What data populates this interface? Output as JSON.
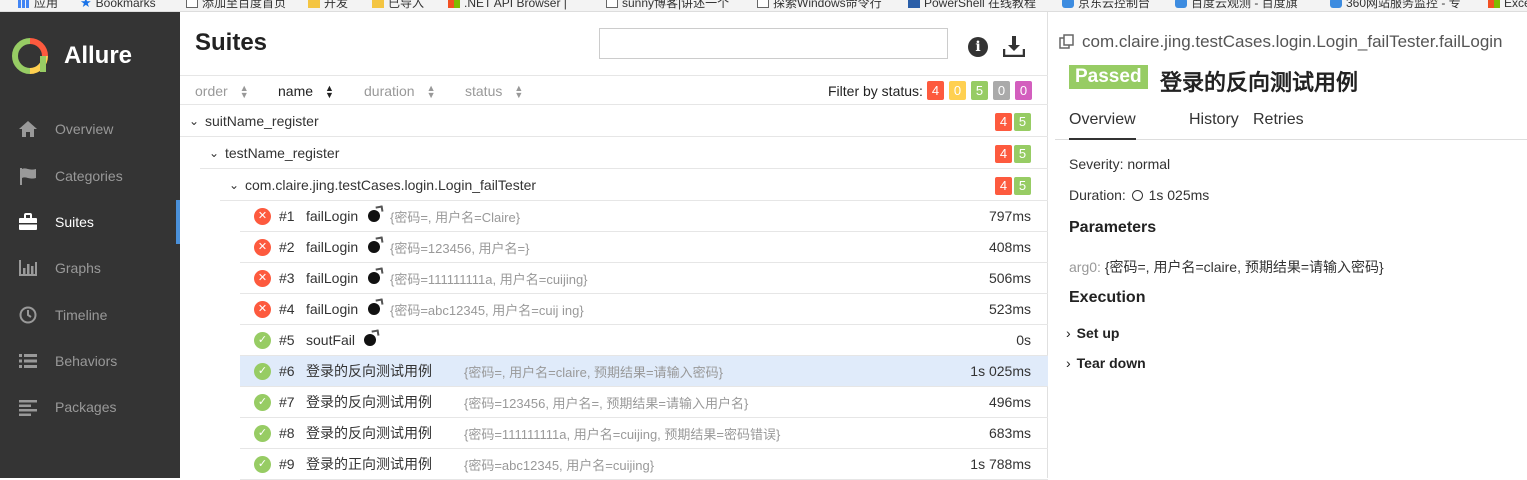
{
  "bookmarks": {
    "items": [
      {
        "label": "应用",
        "icon": "apps-icon"
      },
      {
        "label": "Bookmarks",
        "icon": "star-icon"
      },
      {
        "label": "添加至百度首页",
        "icon": "page-icon"
      },
      {
        "label": "开发",
        "icon": "folder-icon"
      },
      {
        "label": "已导入",
        "icon": "folder-icon"
      },
      {
        "label": ".NET API Browser | ",
        "icon": "microsoft-icon"
      },
      {
        "label": "sunny博客|讲述一个",
        "icon": "page-icon"
      },
      {
        "label": "探索Windows命令行",
        "icon": "page-icon"
      },
      {
        "label": "PowerShell 在线教程",
        "icon": "powershell-icon"
      },
      {
        "label": "京东云控制台",
        "icon": "cloud-icon"
      },
      {
        "label": "百度云观测 - 百度旗",
        "icon": "cloud-icon"
      },
      {
        "label": "360网站服务监控 - 专",
        "icon": "cloud-icon"
      },
      {
        "label": "Exce",
        "icon": "excel-icon"
      }
    ]
  },
  "sidebar": {
    "brand": "Allure",
    "items": [
      {
        "label": "Overview",
        "icon": "home-icon"
      },
      {
        "label": "Categories",
        "icon": "flag-icon"
      },
      {
        "label": "Suites",
        "icon": "briefcase-icon",
        "active": true
      },
      {
        "label": "Graphs",
        "icon": "bar-chart-icon"
      },
      {
        "label": "Timeline",
        "icon": "clock-icon"
      },
      {
        "label": "Behaviors",
        "icon": "list-icon"
      },
      {
        "label": "Packages",
        "icon": "align-left-icon"
      }
    ]
  },
  "suites": {
    "title": "Suites",
    "search_value": "",
    "info_label": "i",
    "sort": {
      "order": "order",
      "name": "name",
      "duration": "duration",
      "status": "status"
    },
    "filter": {
      "label": "Filter by status:",
      "failed": "4",
      "broken": "0",
      "passed": "5",
      "skipped": "0",
      "unknown": "0"
    },
    "groups": [
      {
        "name": "suitName_register",
        "failed": "4",
        "passed": "5"
      },
      {
        "name": "testName_register",
        "failed": "4",
        "passed": "5"
      },
      {
        "name": "com.claire.jing.testCases.login.Login_failTester",
        "failed": "4",
        "passed": "5"
      }
    ],
    "tests": [
      {
        "status": "failed",
        "num": "#1",
        "name": "failLogin",
        "params": "{密码=, 用户名=Claire}",
        "duration": "797ms",
        "bomb": true
      },
      {
        "status": "failed",
        "num": "#2",
        "name": "failLogin",
        "params": "{密码=123456, 用户名=}",
        "duration": "408ms",
        "bomb": true
      },
      {
        "status": "failed",
        "num": "#3",
        "name": "failLogin",
        "params": "{密码=111111111a, 用户名=cuijing}",
        "duration": "506ms",
        "bomb": true
      },
      {
        "status": "failed",
        "num": "#4",
        "name": "failLogin",
        "params": "{密码=abc12345, 用户名=cuij ing}",
        "duration": "523ms",
        "bomb": true
      },
      {
        "status": "passed",
        "num": "#5",
        "name": "soutFail",
        "params": "",
        "duration": "0s",
        "bomb": true
      },
      {
        "status": "passed",
        "num": "#6",
        "name": "登录的反向测试用例",
        "params": "{密码=, 用户名=claire, 预期结果=请输入密码}",
        "duration": "1s 025ms",
        "bomb": false,
        "selected": true
      },
      {
        "status": "passed",
        "num": "#7",
        "name": "登录的反向测试用例",
        "params": "{密码=123456, 用户名=, 预期结果=请输入用户名}",
        "duration": "496ms",
        "bomb": false
      },
      {
        "status": "passed",
        "num": "#8",
        "name": "登录的反向测试用例",
        "params": "{密码=111111111a, 用户名=cuijing, 预期结果=密码错误}",
        "duration": "683ms",
        "bomb": false
      },
      {
        "status": "passed",
        "num": "#9",
        "name": "登录的正向测试用例",
        "params": "{密码=abc12345, 用户名=cuijing}",
        "duration": "1s 788ms",
        "bomb": false
      }
    ]
  },
  "detail": {
    "breadcrumb": "com.claire.jing.testCases.login.Login_failTester.failLogin",
    "status": "Passed",
    "title": "登录的反向测试用例",
    "tabs": [
      "Overview",
      "History",
      "Retries"
    ],
    "severity": "Severity: normal",
    "duration_label": "Duration:",
    "duration_value": "1s 025ms",
    "parameters_heading": "Parameters",
    "param_key": "arg0:",
    "param_value": "{密码=, 用户名=claire, 预期结果=请输入密码}",
    "execution_heading": "Execution",
    "setup": "Set up",
    "teardown": "Tear down"
  },
  "colors": {
    "failed": "#fd5a3e",
    "broken": "#ffd050",
    "passed": "#97cc64",
    "skipped": "#aaaaaa",
    "unknown": "#d35ebe",
    "sidebar": "#343434",
    "accent": "#4a90d9"
  }
}
